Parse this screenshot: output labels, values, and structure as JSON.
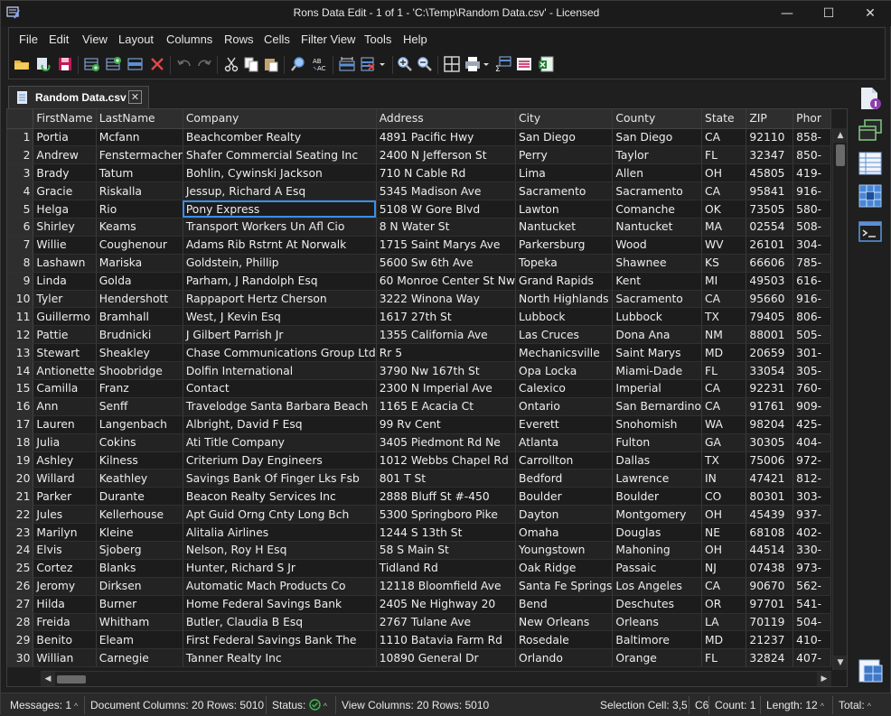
{
  "window": {
    "title": "Rons Data Edit - 1 of 1 - 'C:\\Temp\\Random Data.csv' - Licensed",
    "minimize": "—",
    "maximize": "☐",
    "close": "✕"
  },
  "menu": [
    "File",
    "Edit",
    "View",
    "Layout",
    "Columns",
    "Rows",
    "Cells",
    "Filter View",
    "Tools",
    "Help"
  ],
  "toolbar_icons": [
    "open-folder-icon",
    "reload-icon",
    "save-icon",
    "add-column-icon",
    "insert-column-icon",
    "edit-column-icon",
    "delete-icon",
    "undo-icon",
    "redo-icon",
    "cut-icon",
    "copy-icon",
    "paste-icon",
    "find-icon",
    "replace-icon",
    "fit-columns-icon",
    "clear-filter-icon",
    "zoom-in-icon",
    "zoom-out-icon",
    "grid-layout-icon",
    "print-icon",
    "sum-icon",
    "form-view-icon",
    "export-excel-icon"
  ],
  "tab": {
    "label": "Random Data.csv",
    "close": "✕"
  },
  "grid": {
    "columns": [
      "FirstName",
      "LastName",
      "Company",
      "Address",
      "City",
      "County",
      "State",
      "ZIP",
      "Phor"
    ],
    "selected": {
      "row": 5,
      "col": 2
    },
    "rows": [
      [
        "1",
        "Portia",
        "Mcfann",
        "Beachcomber Realty",
        "4891 Pacific Hwy",
        "San Diego",
        "San Diego",
        "CA",
        "92110",
        "858-"
      ],
      [
        "2",
        "Andrew",
        "Fenstermacher",
        "Shafer Commercial Seating Inc",
        "2400 N Jefferson St",
        "Perry",
        "Taylor",
        "FL",
        "32347",
        "850-"
      ],
      [
        "3",
        "Brady",
        "Tatum",
        "Bohlin, Cywinski Jackson",
        "710 N Cable Rd",
        "Lima",
        "Allen",
        "OH",
        "45805",
        "419-"
      ],
      [
        "4",
        "Gracie",
        "Riskalla",
        "Jessup, Richard A Esq",
        "5345 Madison Ave",
        "Sacramento",
        "Sacramento",
        "CA",
        "95841",
        "916-"
      ],
      [
        "5",
        "Helga",
        "Rio",
        "Pony Express",
        "5108 W Gore Blvd",
        "Lawton",
        "Comanche",
        "OK",
        "73505",
        "580-"
      ],
      [
        "6",
        "Shirley",
        "Keams",
        "Transport Workers Un Afl Cio",
        "8 N Water St",
        "Nantucket",
        "Nantucket",
        "MA",
        "02554",
        "508-"
      ],
      [
        "7",
        "Willie",
        "Coughenour",
        "Adams Rib Rstrnt At Norwalk",
        "1715 Saint Marys Ave",
        "Parkersburg",
        "Wood",
        "WV",
        "26101",
        "304-"
      ],
      [
        "8",
        "Lashawn",
        "Mariska",
        "Goldstein, Phillip",
        "5600 Sw 6th Ave",
        "Topeka",
        "Shawnee",
        "KS",
        "66606",
        "785-"
      ],
      [
        "9",
        "Linda",
        "Golda",
        "Parham, J Randolph Esq",
        "60 Monroe Center St Nw",
        "Grand Rapids",
        "Kent",
        "MI",
        "49503",
        "616-"
      ],
      [
        "10",
        "Tyler",
        "Hendershott",
        "Rappaport Hertz Cherson",
        "3222 Winona Way",
        "North Highlands",
        "Sacramento",
        "CA",
        "95660",
        "916-"
      ],
      [
        "11",
        "Guillermo",
        "Bramhall",
        "West, J Kevin Esq",
        "1617 27th St",
        "Lubbock",
        "Lubbock",
        "TX",
        "79405",
        "806-"
      ],
      [
        "12",
        "Pattie",
        "Brudnicki",
        "J Gilbert Parrish Jr",
        "1355 California Ave",
        "Las Cruces",
        "Dona Ana",
        "NM",
        "88001",
        "505-"
      ],
      [
        "13",
        "Stewart",
        "Sheakley",
        "Chase Communications Group Ltd",
        "Rr 5",
        "Mechanicsville",
        "Saint Marys",
        "MD",
        "20659",
        "301-"
      ],
      [
        "14",
        "Antionette",
        "Shoobridge",
        "Dolfin International",
        "3790 Nw 167th St",
        "Opa Locka",
        "Miami-Dade",
        "FL",
        "33054",
        "305-"
      ],
      [
        "15",
        "Camilla",
        "Franz",
        "Contact",
        "2300 N Imperial Ave",
        "Calexico",
        "Imperial",
        "CA",
        "92231",
        "760-"
      ],
      [
        "16",
        "Ann",
        "Senff",
        "Travelodge Santa Barbara Beach",
        "1165 E Acacia Ct",
        "Ontario",
        "San Bernardino",
        "CA",
        "91761",
        "909-"
      ],
      [
        "17",
        "Lauren",
        "Langenbach",
        "Albright, David F Esq",
        "99 Rv Cent",
        "Everett",
        "Snohomish",
        "WA",
        "98204",
        "425-"
      ],
      [
        "18",
        "Julia",
        "Cokins",
        "Ati Title Company",
        "3405 Piedmont Rd Ne",
        "Atlanta",
        "Fulton",
        "GA",
        "30305",
        "404-"
      ],
      [
        "19",
        "Ashley",
        "Kilness",
        "Criterium Day Engineers",
        "1012 Webbs Chapel Rd",
        "Carrollton",
        "Dallas",
        "TX",
        "75006",
        "972-"
      ],
      [
        "20",
        "Willard",
        "Keathley",
        "Savings Bank Of Finger Lks Fsb",
        "801 T St",
        "Bedford",
        "Lawrence",
        "IN",
        "47421",
        "812-"
      ],
      [
        "21",
        "Parker",
        "Durante",
        "Beacon Realty Services Inc",
        "2888 Bluff St  #-450",
        "Boulder",
        "Boulder",
        "CO",
        "80301",
        "303-"
      ],
      [
        "22",
        "Jules",
        "Kellerhouse",
        "Apt Guid Orng Cnty Long Bch",
        "5300 Springboro Pike",
        "Dayton",
        "Montgomery",
        "OH",
        "45439",
        "937-"
      ],
      [
        "23",
        "Marilyn",
        "Kleine",
        "Alitalia Airlines",
        "1244 S 13th St",
        "Omaha",
        "Douglas",
        "NE",
        "68108",
        "402-"
      ],
      [
        "24",
        "Elvis",
        "Sjoberg",
        "Nelson, Roy H Esq",
        "58 S Main St",
        "Youngstown",
        "Mahoning",
        "OH",
        "44514",
        "330-"
      ],
      [
        "25",
        "Cortez",
        "Blanks",
        "Hunter, Richard S Jr",
        "Tidland Rd",
        "Oak Ridge",
        "Passaic",
        "NJ",
        "07438",
        "973-"
      ],
      [
        "26",
        "Jeromy",
        "Dirksen",
        "Automatic Mach Products Co",
        "12118 Bloomfield Ave",
        "Santa Fe Springs",
        "Los Angeles",
        "CA",
        "90670",
        "562-"
      ],
      [
        "27",
        "Hilda",
        "Burner",
        "Home Federal Savings Bank",
        "2405 Ne Highway 20",
        "Bend",
        "Deschutes",
        "OR",
        "97701",
        "541-"
      ],
      [
        "28",
        "Freida",
        "Whitham",
        "Butler, Claudia B Esq",
        "2767 Tulane Ave",
        "New Orleans",
        "Orleans",
        "LA",
        "70119",
        "504-"
      ],
      [
        "29",
        "Benito",
        "Eleam",
        "First Federal Savings Bank The",
        "1110 Batavia Farm Rd",
        "Rosedale",
        "Baltimore",
        "MD",
        "21237",
        "410-"
      ],
      [
        "30",
        "Willian",
        "Carnegie",
        "Tanner Realty Inc",
        "10890 General Dr",
        "Orlando",
        "Orange",
        "FL",
        "32824",
        "407-"
      ]
    ]
  },
  "status": {
    "messages": "Messages: 1",
    "document": "Document Columns: 20 Rows: 5010",
    "status_label": "Status:",
    "view": "View Columns: 20 Rows: 5010",
    "selection": "Selection Cell: 3,5",
    "cell": "C6",
    "count": "Count: 1",
    "length": "Length: 12",
    "total": "Total:"
  },
  "colors": {
    "selection": "#3a8ee6",
    "status_ok": "#3fb950",
    "accent": "#4a9fe0"
  }
}
